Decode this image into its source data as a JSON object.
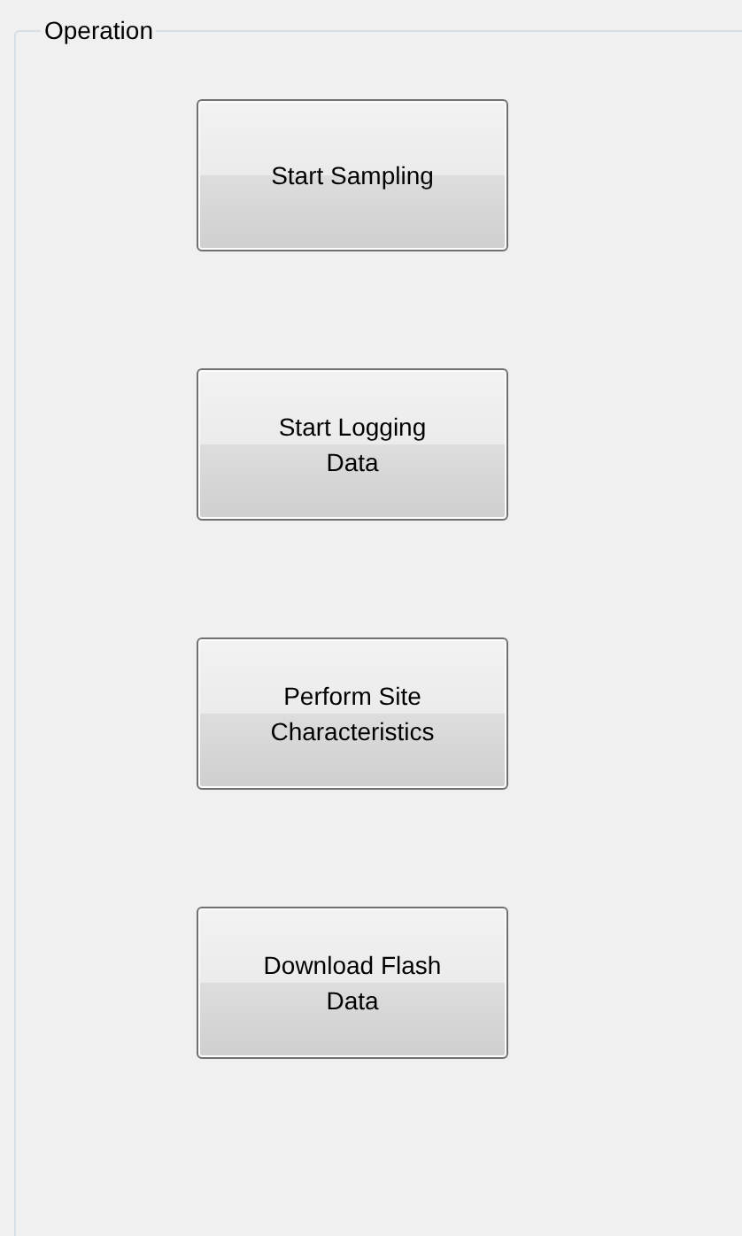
{
  "group": {
    "title": "Operation"
  },
  "buttons": [
    {
      "label": "Start Sampling"
    },
    {
      "label": "Start Logging\nData"
    },
    {
      "label": "Perform Site\nCharacteristics"
    },
    {
      "label": "Download Flash\nData"
    }
  ]
}
